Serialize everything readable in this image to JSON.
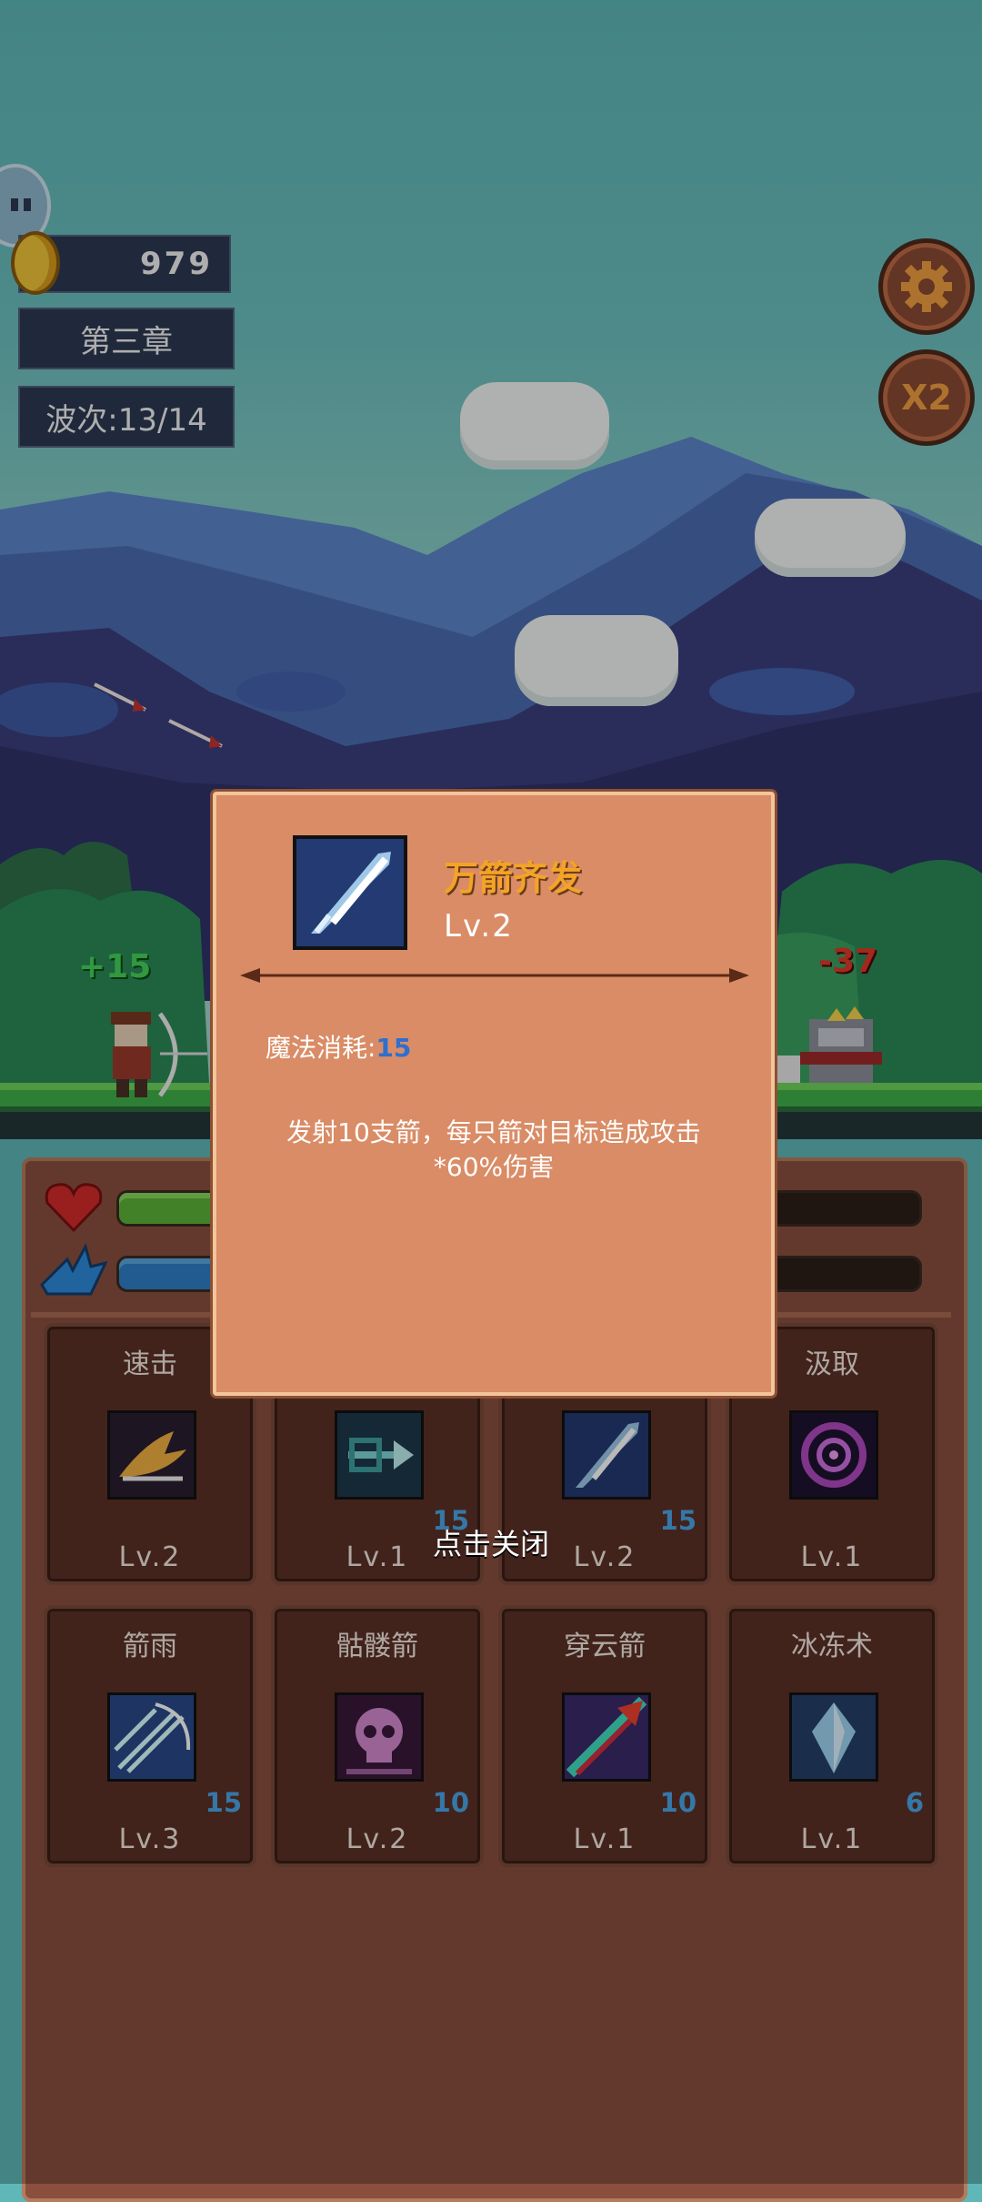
{
  "hud": {
    "coins": "979",
    "chapter": "第三章",
    "wave": "波次:13/14",
    "speed_label": "X2"
  },
  "battle": {
    "player_heal_text": "+15",
    "enemy_damage_text": "-37"
  },
  "popup": {
    "skill_name": "万箭齐发",
    "skill_level": "Lv.2",
    "mana_cost_label": "魔法消耗:",
    "mana_cost_value": "15",
    "description": "发射10支箭，每只箭对目标造成攻击*60%伤害",
    "close_hint": "点击关闭"
  },
  "stats": {
    "health_fraction": 0.55,
    "mana_fraction": 0.42
  },
  "skills": [
    {
      "name": "速击",
      "cost": "",
      "level": "Lv.2",
      "icon": "speed-strike-icon"
    },
    {
      "name": "",
      "cost": "15",
      "level": "Lv.1",
      "icon": "piercing-arrow-icon"
    },
    {
      "name": "",
      "cost": "15",
      "level": "Lv.2",
      "icon": "arrow-volley-icon"
    },
    {
      "name": "汲取",
      "cost": "",
      "level": "Lv.1",
      "icon": "vortex-drain-icon"
    },
    {
      "name": "箭雨",
      "cost": "15",
      "level": "Lv.3",
      "icon": "arrow-rain-icon"
    },
    {
      "name": "骷髅箭",
      "cost": "10",
      "level": "Lv.2",
      "icon": "skull-arrow-icon"
    },
    {
      "name": "穿云箭",
      "cost": "10",
      "level": "Lv.1",
      "icon": "cloud-piercer-icon"
    },
    {
      "name": "冰冻术",
      "cost": "6",
      "level": "Lv.1",
      "icon": "ice-crystal-icon"
    }
  ]
}
